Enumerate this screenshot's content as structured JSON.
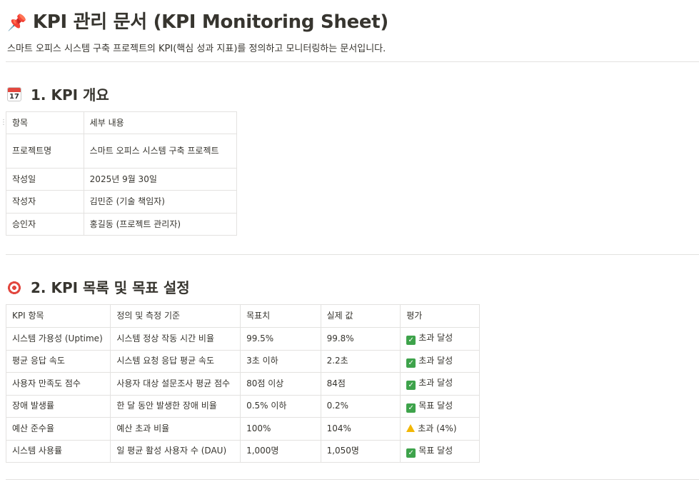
{
  "page": {
    "title_emoji": "📌",
    "title": "KPI 관리 문서 (KPI Monitoring Sheet)",
    "description": "스마트 오피스 시스템 구축 프로젝트의 KPI(핵심 성과 지표)를 정의하고 모니터링하는 문서입니다."
  },
  "section1": {
    "heading": "1. KPI 개요",
    "icon": "calendar-icon",
    "calendar_day": "17",
    "rows": [
      [
        "항목",
        "세부 내용"
      ],
      [
        "프로젝트명",
        "스마트 오피스 시스템 구축 프로젝트"
      ],
      [
        "작성일",
        "2025년 9월 30일"
      ],
      [
        "작성자",
        "김민준 (기술 책임자)"
      ],
      [
        "승인자",
        "홍길동 (프로젝트 관리자)"
      ]
    ]
  },
  "section2": {
    "heading": "2. KPI 목록 및 목표 설정",
    "icon": "target-icon",
    "headers": [
      "KPI 항목",
      "정의 및 측정 기준",
      "목표치",
      "실제 값",
      "평가"
    ],
    "rows": [
      {
        "kpi": "시스템 가용성 (Uptime)",
        "def": "시스템 정상 작동 시간 비율",
        "target": "99.5%",
        "actual": "99.8%",
        "status_icon": "check-icon",
        "status": "초과 달성"
      },
      {
        "kpi": "평균 응답 속도",
        "def": "시스템 요청 응답 평균 속도",
        "target": "3초 이하",
        "actual": "2.2초",
        "status_icon": "check-icon",
        "status": "초과 달성"
      },
      {
        "kpi": "사용자 만족도 점수",
        "def": "사용자 대상 설문조사 평균 점수",
        "target": "80점 이상",
        "actual": "84점",
        "status_icon": "check-icon",
        "status": "초과 달성"
      },
      {
        "kpi": "장애 발생률",
        "def": "한 달 동안 발생한 장애 비율",
        "target": "0.5% 이하",
        "actual": "0.2%",
        "status_icon": "check-icon",
        "status": "목표 달성"
      },
      {
        "kpi": "예산 준수율",
        "def": "예산 초과 비율",
        "target": "100%",
        "actual": "104%",
        "status_icon": "warning-icon",
        "status": "초과 (4%)"
      },
      {
        "kpi": "시스템 사용률",
        "def": "일 평균 활성 사용자 수 (DAU)",
        "target": "1,000명",
        "actual": "1,050명",
        "status_icon": "check-icon",
        "status": "목표 달성"
      }
    ]
  }
}
